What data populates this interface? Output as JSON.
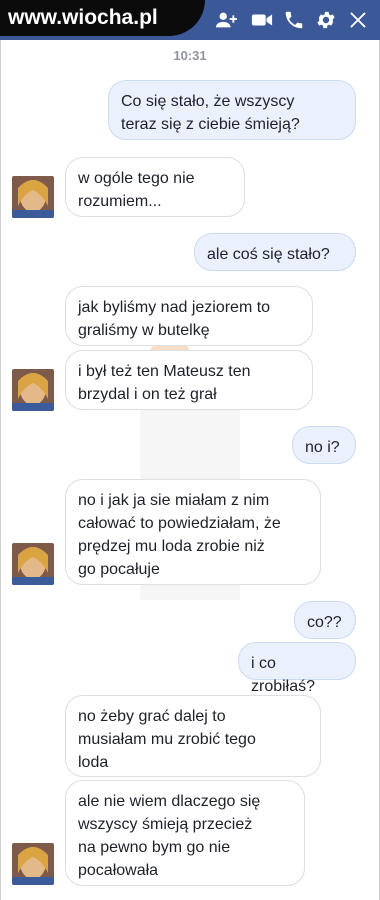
{
  "header": {
    "site_logo_text": "www.wiocha.pl",
    "icons": [
      "add-user-icon",
      "video-call-icon",
      "phone-icon",
      "gear-icon",
      "close-icon"
    ]
  },
  "conversation": {
    "timestamp": "10:31",
    "messages": [
      {
        "sender": "me",
        "text": "Co się stało, że wszyscy\nteraz się z ciebie śmieją?"
      },
      {
        "sender": "them",
        "text": "w ogóle tego nie\nrozumiem..."
      },
      {
        "sender": "me",
        "text": "ale coś się stało?"
      },
      {
        "sender": "them",
        "text": "jak byliśmy nad jeziorem to\ngraliśmy w butelkę"
      },
      {
        "sender": "them",
        "text": "i był też ten Mateusz ten\nbrzydal i on też grał"
      },
      {
        "sender": "me",
        "text": "no i?"
      },
      {
        "sender": "them",
        "text": "no i jak ja sie miałam z nim\ncałować to powiedziałam, że\nprędzej mu loda zrobie niż\ngo pocałuje"
      },
      {
        "sender": "me",
        "text": "co??"
      },
      {
        "sender": "me",
        "text": "i co zrobiłaś?"
      },
      {
        "sender": "them",
        "text": "no żeby grać dalej to\nmusiałam mu zrobić tego\nloda"
      },
      {
        "sender": "them",
        "text": "ale nie wiem dlaczego się\nwszyscy śmieją przecież\nna pewno bym go nie\npocałowała"
      }
    ]
  },
  "colors": {
    "header_bg": "#3b5998",
    "outgoing_bubble": "#eaf1fc",
    "incoming_bubble": "#ffffff"
  }
}
